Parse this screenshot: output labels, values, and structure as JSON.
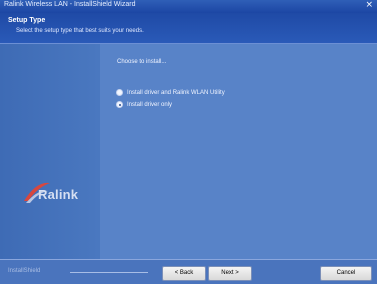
{
  "window": {
    "title": "Ralink Wireless LAN - InstallShield Wizard",
    "close_glyph": "×"
  },
  "header": {
    "title": "Setup Type",
    "subtitle": "Select the setup type that best suits your needs."
  },
  "content": {
    "prompt": "Choose to install...",
    "options": [
      {
        "label": "Install driver and Ralink WLAN Utility",
        "selected": false
      },
      {
        "label": "Install driver only",
        "selected": true
      }
    ]
  },
  "logo": {
    "text": "Ralink",
    "icon": "ralink-swoosh-icon"
  },
  "footer": {
    "brand": "InstallShield",
    "back_label": "< Back",
    "next_label": "Next >",
    "cancel_label": "Cancel"
  },
  "colors": {
    "accent": "#1f4aa6",
    "panel": "#5883c8"
  }
}
